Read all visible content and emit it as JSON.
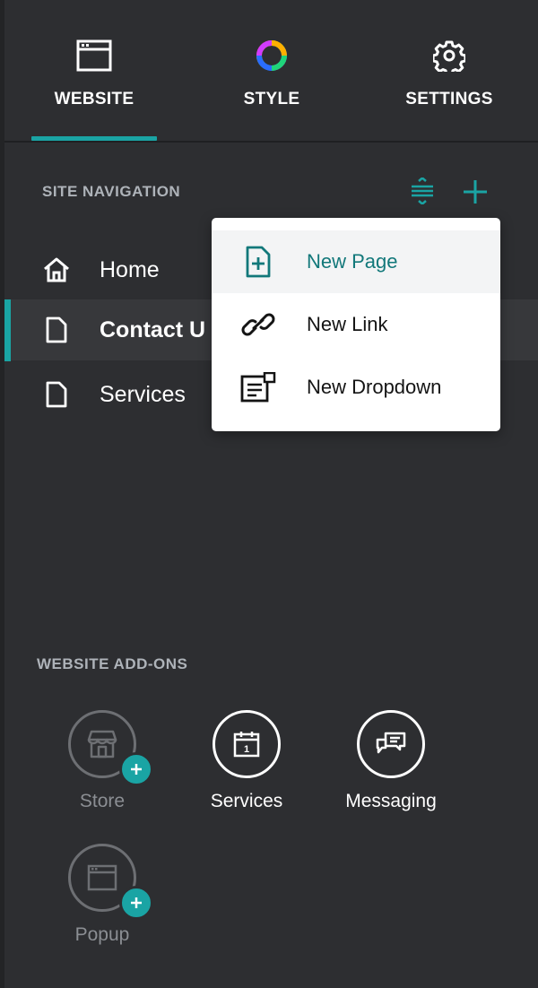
{
  "tabs": [
    {
      "label": "WEBSITE",
      "icon": "browser-window-icon",
      "active": true
    },
    {
      "label": "STYLE",
      "icon": "color-wheel-icon",
      "active": false
    },
    {
      "label": "SETTINGS",
      "icon": "gear-icon",
      "active": false
    }
  ],
  "site_navigation": {
    "title": "SITE NAVIGATION",
    "items": [
      {
        "label": "Home",
        "icon": "home-icon"
      },
      {
        "label": "Contact U",
        "icon": "page-icon",
        "active": true
      },
      {
        "label": "Services",
        "icon": "page-icon"
      }
    ]
  },
  "dropdown_menu": {
    "items": [
      {
        "label": "New Page",
        "icon": "new-page-icon",
        "highlighted": true
      },
      {
        "label": "New Link",
        "icon": "link-icon"
      },
      {
        "label": "New Dropdown",
        "icon": "dropdown-icon"
      }
    ]
  },
  "addons": {
    "title": "WEBSITE ADD-ONS",
    "items": [
      {
        "label": "Store",
        "icon": "storefront-icon",
        "enabled": false
      },
      {
        "label": "Services",
        "icon": "calendar-icon",
        "enabled": true
      },
      {
        "label": "Messaging",
        "icon": "chat-icon",
        "enabled": true
      },
      {
        "label": "Popup",
        "icon": "popup-window-icon",
        "enabled": false
      }
    ]
  },
  "colors": {
    "background": "#2d2e31",
    "accent": "#1aa4a4",
    "accent_text": "#12787a",
    "muted_text": "#aeb3b9"
  }
}
